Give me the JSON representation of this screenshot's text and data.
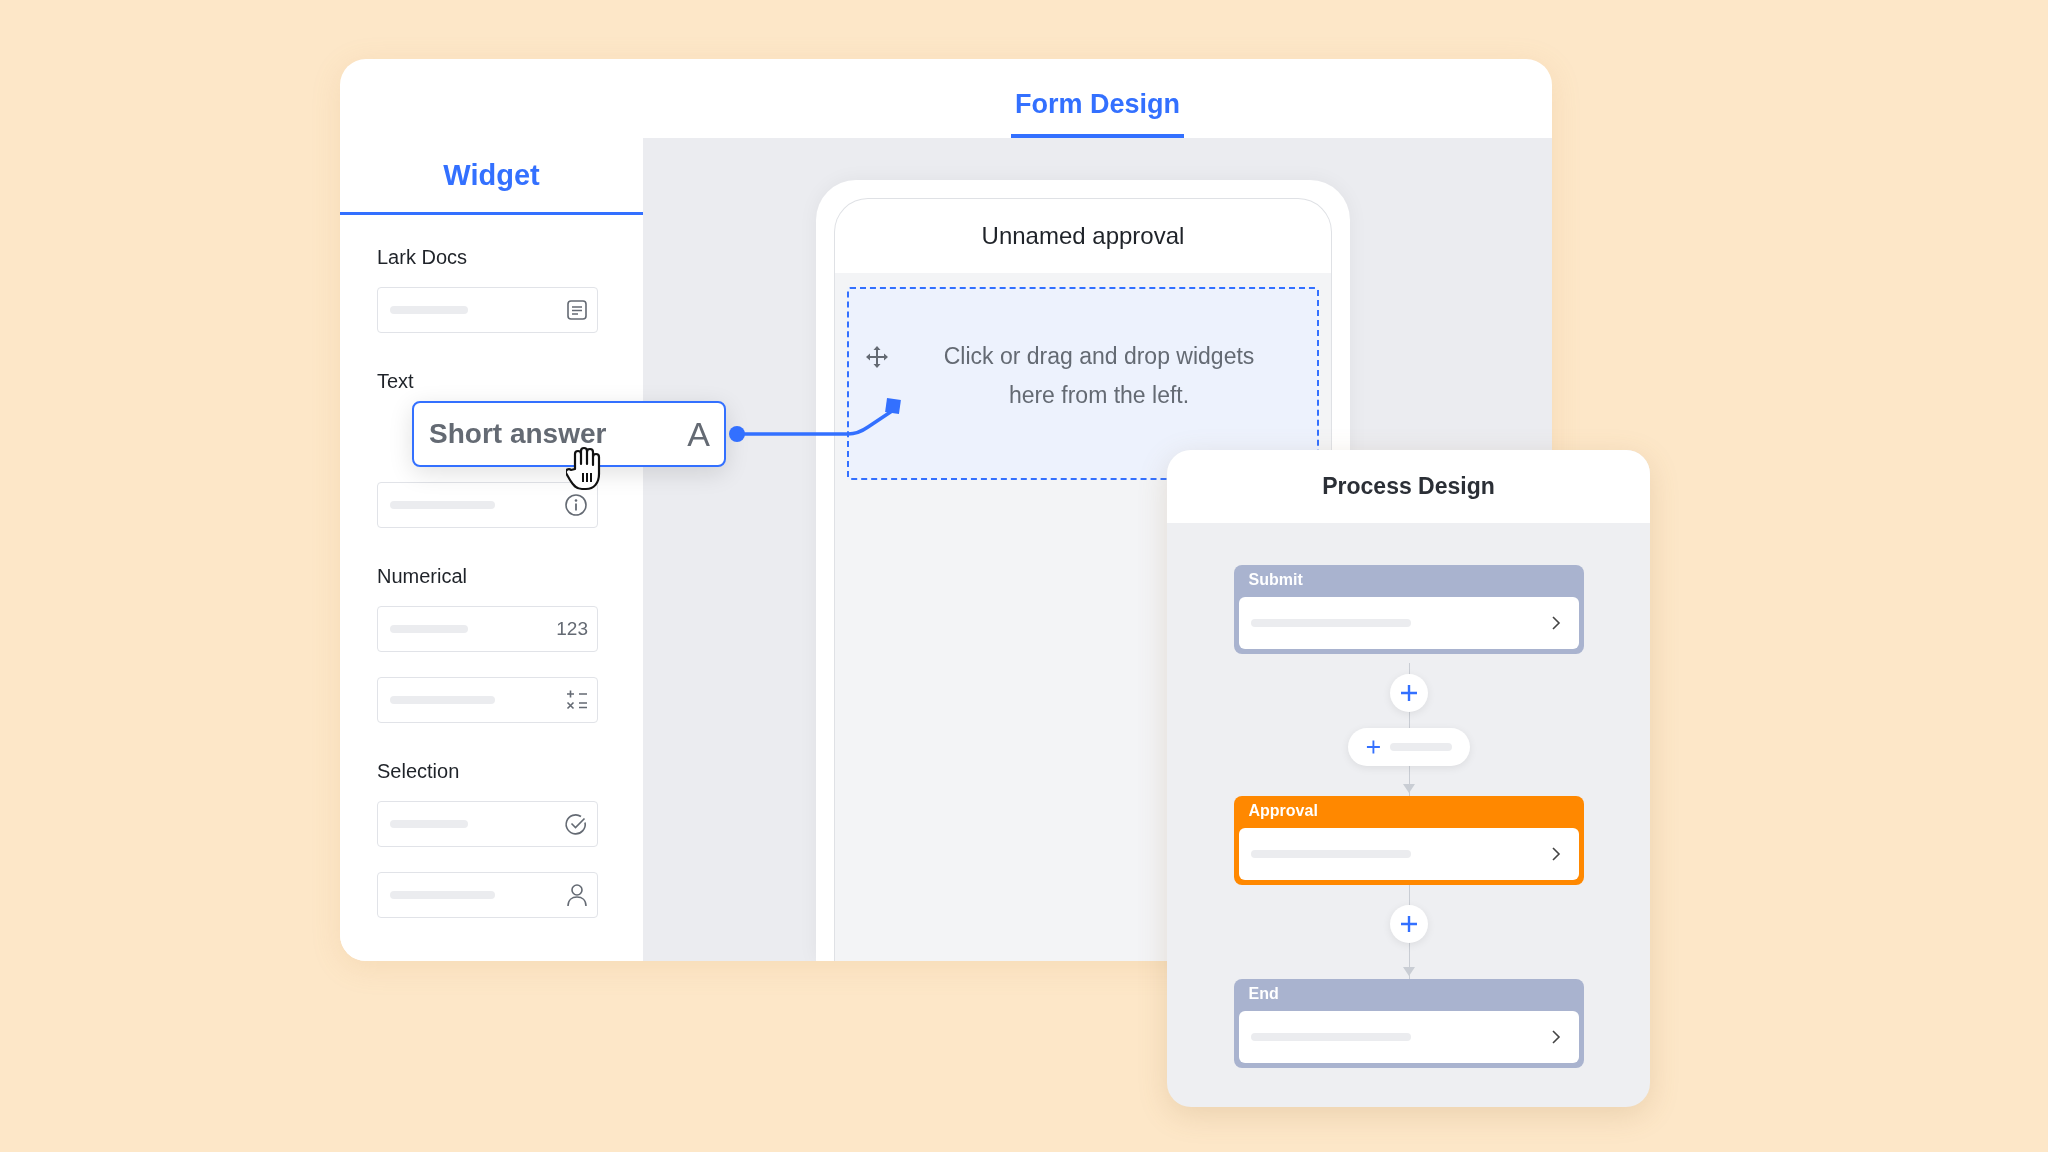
{
  "form_header": {
    "tabs": [
      {
        "label": "Form Design",
        "selected": true
      }
    ]
  },
  "widget_panel": {
    "title": "Widget",
    "groups": [
      {
        "label": "Lark Docs",
        "items": [
          {
            "kind": "doc"
          }
        ]
      },
      {
        "label": "Text",
        "items": [
          {
            "kind": "dragged",
            "label": "Short answer",
            "glyph": "A"
          },
          {
            "kind": "info"
          }
        ]
      },
      {
        "label": "Numerical",
        "items": [
          {
            "kind": "number",
            "text": "123"
          },
          {
            "kind": "formula"
          }
        ]
      },
      {
        "label": "Selection",
        "items": [
          {
            "kind": "check"
          },
          {
            "kind": "person"
          }
        ]
      }
    ]
  },
  "canvas": {
    "title": "Unnamed approval",
    "drop_zone": {
      "hint": "Click or drag and drop widgets here from the left."
    }
  },
  "process_panel": {
    "title": "Process Design",
    "steps": [
      {
        "kind": "node",
        "label": "Submit",
        "color": "#a9b3cf"
      },
      {
        "kind": "add"
      },
      {
        "kind": "add-branch"
      },
      {
        "kind": "node",
        "label": "Approval",
        "color": "#ff8800"
      },
      {
        "kind": "add"
      },
      {
        "kind": "node",
        "label": "End",
        "color": "#a9b3cf"
      }
    ]
  }
}
